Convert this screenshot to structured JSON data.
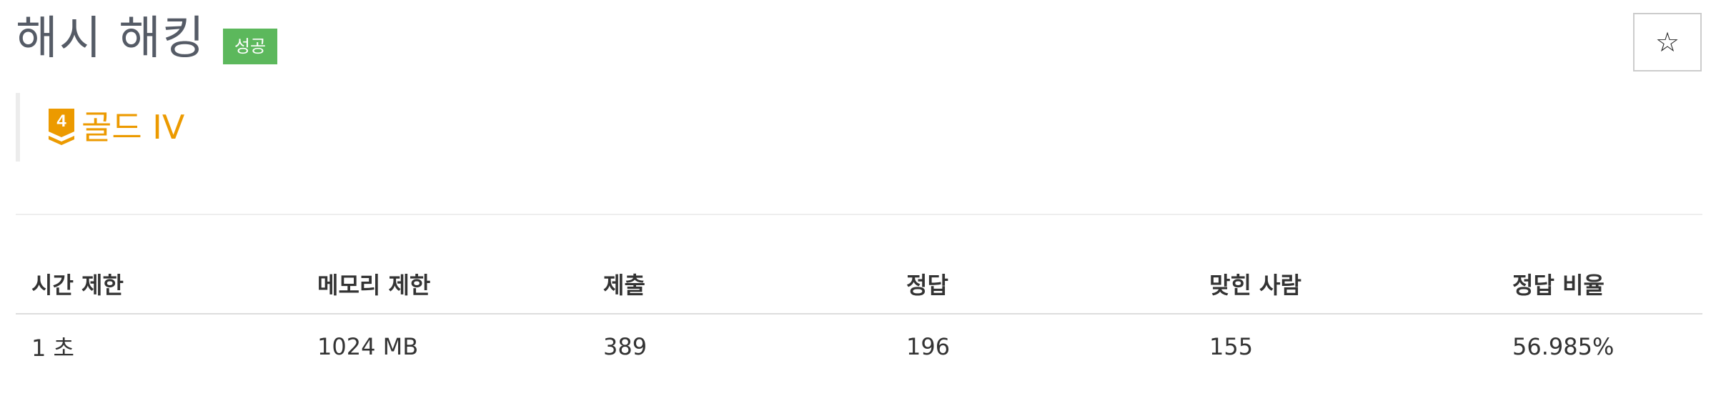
{
  "problem": {
    "title": "해시 해킹",
    "status_badge": "성공",
    "tier": {
      "label": "골드 IV",
      "level_number": "4",
      "color": "#ec9a00"
    },
    "star_icon": "star-outline-icon"
  },
  "stats": {
    "headers": [
      "시간 제한",
      "메모리 제한",
      "제출",
      "정답",
      "맞힌 사람",
      "정답 비율"
    ],
    "values": [
      "1 초",
      "1024 MB",
      "389",
      "196",
      "155",
      "56.985%"
    ]
  },
  "colors": {
    "badge_success": "#5cb85c",
    "title_text": "#555b66",
    "tier_gold": "#ec9a00"
  }
}
